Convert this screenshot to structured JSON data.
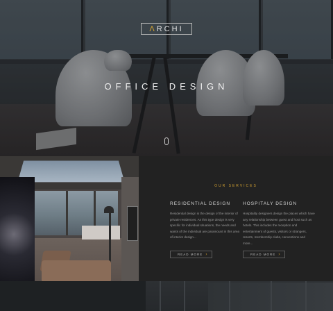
{
  "header": {
    "logo_accent": "Λ",
    "logo_rest": "RCHI",
    "hero_title": "OFFICE DESIGN"
  },
  "services": {
    "heading": "OUR SERVICES",
    "items": [
      {
        "title": "RESIDENTIAL DESIGN",
        "body": "Residential design is the design of the interior of private residences. As this type design is very specific for individual situations, the needs and wants of the individual are paramount in this area of interior design...",
        "button": "READ MORE"
      },
      {
        "title": "HOSPITALY DESIGN",
        "body": "Hospitality designers design the places which have any relationship between guest and host such as hotels. This includes the reception and entertainment of guests, visitors or strangers, resorts, membership clubs, conventions and more...",
        "button": "READ MORE"
      }
    ]
  },
  "icons": {
    "arrow": "›"
  },
  "colors": {
    "accent": "#d0a031",
    "panel": "#222222"
  }
}
